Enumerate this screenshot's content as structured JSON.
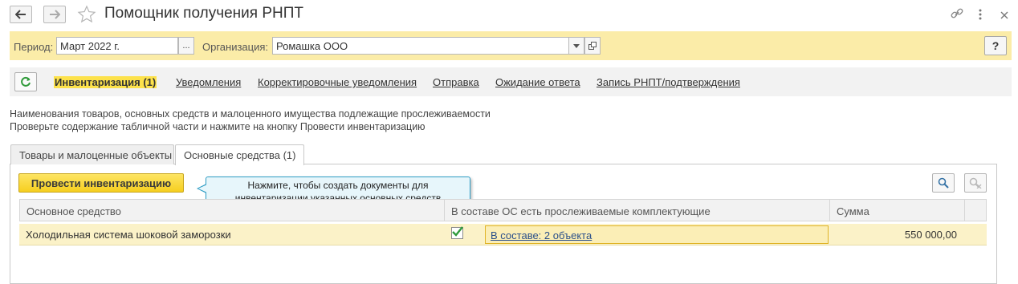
{
  "window": {
    "title": "Помощник получения РНПТ"
  },
  "filters": {
    "period_label": "Период:",
    "period_value": "Март 2022 г.",
    "period_choose": "...",
    "org_label": "Организация:",
    "org_value": "Ромашка ООО",
    "help_label": "?"
  },
  "link_tabs": [
    {
      "label": "Инвентаризация (1)",
      "active": true
    },
    {
      "label": "Уведомления"
    },
    {
      "label": "Корректировочные уведомления"
    },
    {
      "label": "Отправка"
    },
    {
      "label": "Ожидание ответа"
    },
    {
      "label": "Запись РНПТ/подтверждения"
    }
  ],
  "info": {
    "line1": "Наименования товаров, основных средств и малоценного имущества подлежащие прослеживаемости",
    "line2": "Проверьте содержание табличной части и нажмите на кнопку Провести инвентаризацию"
  },
  "inner_tabs": [
    {
      "label": "Товары и малоценные объекты"
    },
    {
      "label": "Основные средства (1)",
      "active": true
    }
  ],
  "toolbar": {
    "main_button": "Провести инвентаризацию",
    "tooltip_line1": "Нажмите, чтобы создать документы для",
    "tooltip_line2": "инвентаризации указанных основных средств"
  },
  "table": {
    "columns": [
      "Основное средство",
      "В составе ОС есть прослеживаемые комплектующие",
      "Сумма"
    ],
    "rows": [
      {
        "asset": "Холодильная система шоковой заморозки",
        "has_components": true,
        "components_link": "В составе: 2 объекта",
        "sum": "550 000,00"
      }
    ]
  },
  "colors": {
    "accent_yellow": "#fde24b",
    "filter_bar": "#fbeca8",
    "tooltip_border": "#2d9cc4",
    "check_green": "#2f9a3a"
  }
}
